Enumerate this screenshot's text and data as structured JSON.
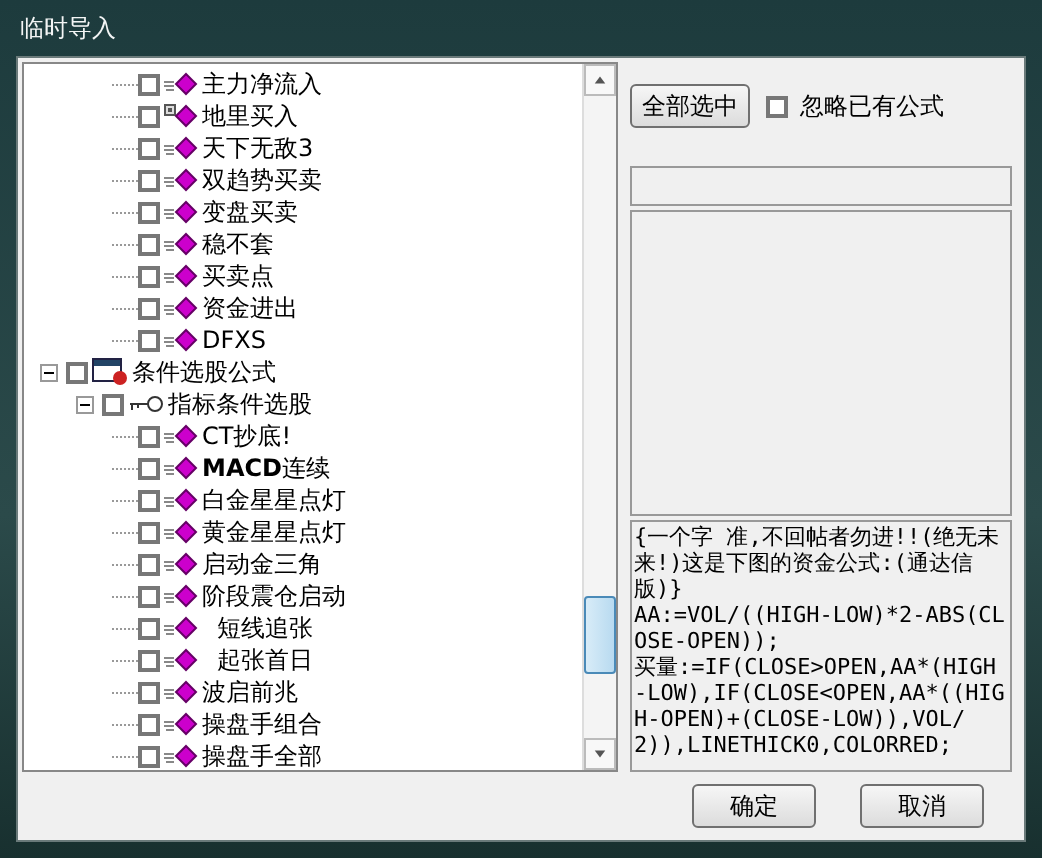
{
  "window": {
    "title": "临时导入"
  },
  "tree": {
    "continued_items": [
      {
        "label": "主力净流入",
        "kind": "formula",
        "checked": false
      },
      {
        "label": "地里买入",
        "kind": "locked-formula",
        "checked": false
      },
      {
        "label": "天下无敌3",
        "kind": "formula",
        "checked": false
      },
      {
        "label": "双趋势买卖",
        "kind": "formula",
        "checked": false
      },
      {
        "label": "变盘买卖",
        "kind": "formula",
        "checked": false
      },
      {
        "label": "稳不套",
        "kind": "formula",
        "checked": false
      },
      {
        "label": "买卖点",
        "kind": "formula",
        "checked": false
      },
      {
        "label": "资金进出",
        "kind": "formula",
        "checked": false
      },
      {
        "label": "DFXS",
        "kind": "formula",
        "checked": false
      }
    ],
    "nodes": [
      {
        "label": "条件选股公式",
        "kind": "category",
        "checked": false,
        "expanded": true,
        "children": [
          {
            "label": "指标条件选股",
            "kind": "group",
            "checked": false,
            "expanded": true,
            "children": [
              {
                "label": "CT抄底!",
                "kind": "formula",
                "checked": false
              },
              {
                "label": "**MACD**连续",
                "kind": "formula",
                "checked": false
              },
              {
                "label": "白金星星点灯",
                "kind": "formula",
                "checked": false
              },
              {
                "label": "黄金星星点灯",
                "kind": "formula",
                "checked": false
              },
              {
                "label": "启动金三角",
                "kind": "formula",
                "checked": false
              },
              {
                "label": "阶段震仓启动",
                "kind": "formula",
                "checked": false
              },
              {
                "label": "  短线追张",
                "kind": "formula",
                "checked": false
              },
              {
                "label": "  起张首日",
                "kind": "formula",
                "checked": false
              },
              {
                "label": "波启前兆",
                "kind": "formula",
                "checked": false
              },
              {
                "label": "操盘手组合",
                "kind": "formula",
                "checked": false
              },
              {
                "label": "操盘手全部",
                "kind": "formula",
                "checked": false
              }
            ]
          }
        ]
      }
    ]
  },
  "select_all_button": "全部选中",
  "ignore_existing": {
    "label": "忽略已有公式",
    "checked": false
  },
  "formula_text": "{一个字 准,不回帖者勿进!!(绝无未来!)这是下图的资金公式:(通达信版)}\nAA:=VOL/((HIGH-LOW)*2-ABS(CLOSE-OPEN));\n买量:=IF(CLOSE>OPEN,AA*(HIGH-LOW),IF(CLOSE<OPEN,AA*((HIGH-OPEN)+(CLOSE-LOW)),VOL/2)),LINETHICK0,COLORRED;",
  "buttons": [
    "确定",
    "取消"
  ]
}
